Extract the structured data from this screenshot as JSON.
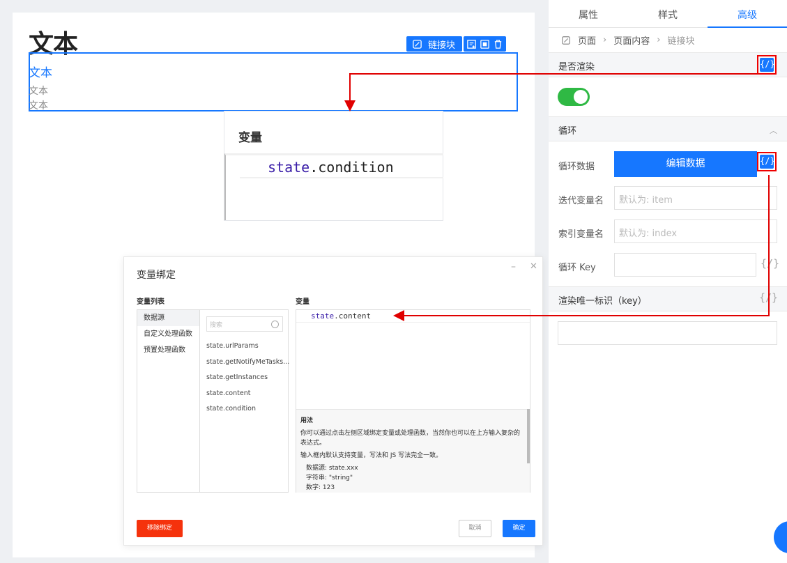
{
  "canvas": {
    "heading": "文本",
    "text_blue": "文本",
    "text_gray_1": "文本",
    "text_gray_2": "文本",
    "toolbar": {
      "link_label": "链接块"
    }
  },
  "var_card": {
    "title": "变量",
    "code_kw": "state",
    "code_rest": ".condition"
  },
  "dialog": {
    "title": "变量绑定",
    "list_label": "变量列表",
    "var_label": "变量",
    "categories": [
      "数据源",
      "自定义处理函数",
      "预置处理函数"
    ],
    "search_placeholder": "搜索",
    "variables": [
      "state.urlParams",
      "state.getNotifyMeTasks...",
      "state.getInstances",
      "state.content",
      "state.condition"
    ],
    "code_kw": "state",
    "code_rest": ".content",
    "help": {
      "heading": "用法",
      "p1": "你可以通过点击左侧区域绑定变量或处理函数，当然你也可以在上方输入复杂的表达式。",
      "p2": "输入框内默认支持变量，写法和 JS 写法完全一致。",
      "ex1": "数据源: state.xxx",
      "ex2": "字符串: \"string\"",
      "ex3": "数字: 123"
    },
    "remove_label": "移除绑定",
    "cancel_label": "取消",
    "ok_label": "确定"
  },
  "panel": {
    "tabs": [
      "属性",
      "样式",
      "高级"
    ],
    "breadcrumb": [
      "页面",
      "页面内容",
      "链接块"
    ],
    "render_section": "是否渲染",
    "render_enabled": true,
    "loop_section": "循环",
    "loop_data_label": "循环数据",
    "edit_data_label": "编辑数据",
    "iter_var_label": "迭代变量名",
    "iter_var_placeholder": "默认为: item",
    "index_var_label": "索引变量名",
    "index_var_placeholder": "默认为: index",
    "loop_key_label": "循环 Key",
    "key_section": "渲染唯一标识（key）",
    "var_icon_text": "{/}"
  },
  "colors": {
    "accent": "#1677ff",
    "danger": "#f5320c",
    "toggle": "#2fb944",
    "annotation": "#e00000"
  }
}
